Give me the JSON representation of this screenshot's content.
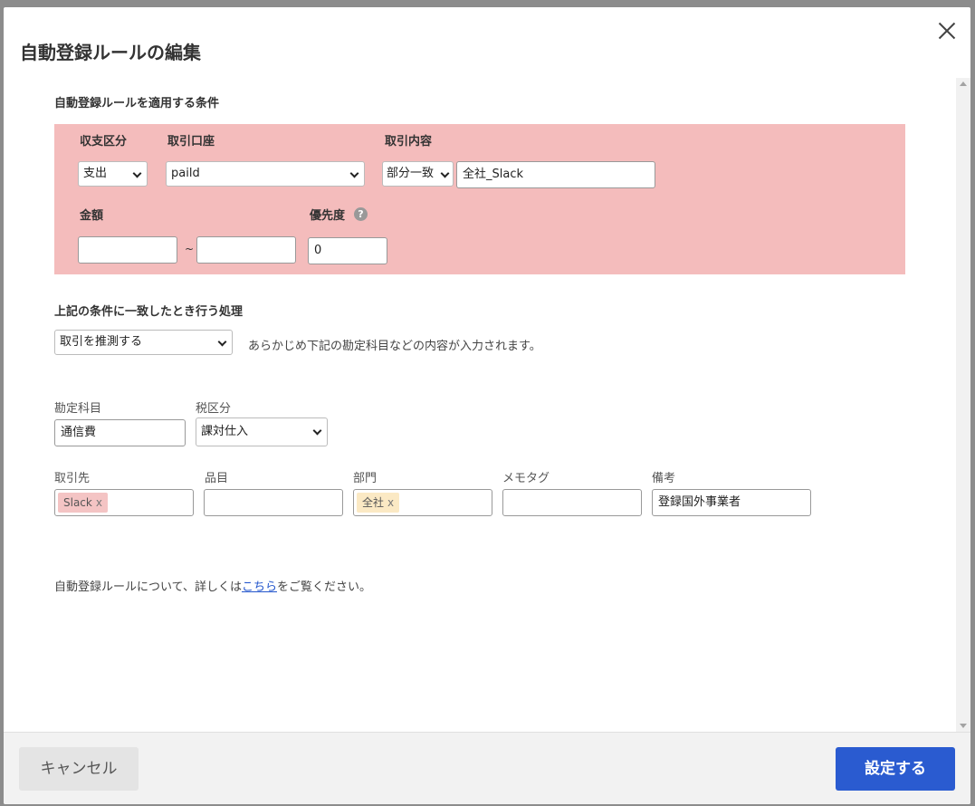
{
  "dialog": {
    "title": "自動登録ルールの編集",
    "close_label": "×"
  },
  "conditions": {
    "heading": "自動登録ルールを適用する条件",
    "type_label": "収支区分",
    "type_value": "支出",
    "account_label": "取引口座",
    "account_value": "paild",
    "content_label": "取引内容",
    "match_value": "部分一致",
    "content_value": "全社_Slack",
    "amount_label": "金額",
    "amount_min": "",
    "amount_max": "",
    "amount_separator": "~",
    "priority_label": "優先度",
    "priority_help": "?",
    "priority_value": "0"
  },
  "action": {
    "heading": "上記の条件に一致したとき行う処理",
    "action_value": "取引を推測する",
    "hint": "あらかじめ下記の勘定科目などの内容が入力されます。"
  },
  "details": {
    "account_item_label": "勘定科目",
    "account_item_value": "通信費",
    "tax_label": "税区分",
    "tax_value": "課対仕入",
    "partner_label": "取引先",
    "partner_tag": "Slack",
    "item_label": "品目",
    "item_value": "",
    "section_label": "部門",
    "section_tag": "全社",
    "memo_tag_label": "メモタグ",
    "memo_tag_value": "",
    "note_label": "備考",
    "note_value": "登録国外事業者",
    "tag_remove": "x"
  },
  "info": {
    "prefix": "自動登録ルールについて、詳しくは",
    "link": "こちら",
    "suffix": "をご覧ください。"
  },
  "footer": {
    "cancel_label": "キャンセル",
    "submit_label": "設定する"
  },
  "colors": {
    "condition_bg": "#f4bcbc",
    "primary_button": "#2a5bd0",
    "partner_tag_bg": "#f4c4c4",
    "section_tag_bg": "#fbe9c4",
    "link": "#2255cc"
  }
}
